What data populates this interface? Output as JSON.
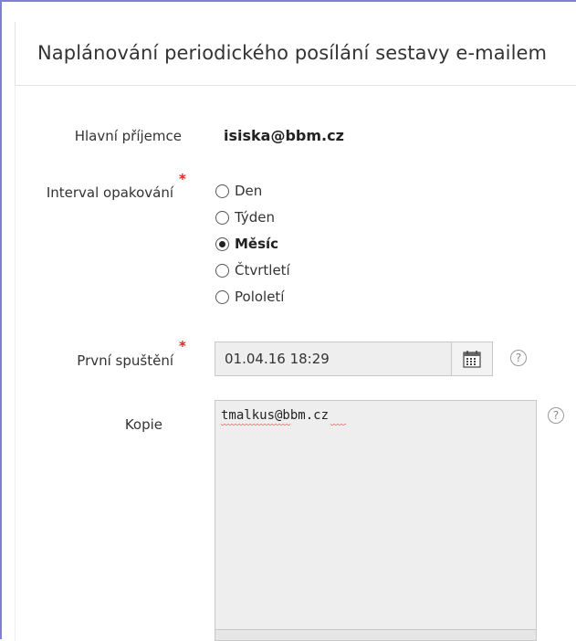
{
  "dialog": {
    "title": "Naplánování periodického posílání sestavy e-mailem"
  },
  "form": {
    "recipient": {
      "label": "Hlavní příjemce",
      "value": "isiska@bbm.cz"
    },
    "interval": {
      "label": "Interval opakování",
      "required_marker": "*",
      "options": [
        {
          "label": "Den",
          "checked": false
        },
        {
          "label": "Týden",
          "checked": false
        },
        {
          "label": "Měsíc",
          "checked": true
        },
        {
          "label": "Čtvrtletí",
          "checked": false
        },
        {
          "label": "Pololetí",
          "checked": false
        }
      ]
    },
    "first_run": {
      "label": "První spuštění",
      "required_marker": "*",
      "value": "01.04.16 18:29"
    },
    "copy": {
      "label": "Kopie",
      "value": "tmalkus@bbm.cz"
    },
    "help_glyph": "?"
  },
  "icons": {
    "calendar": "calendar-icon",
    "help": "help-icon",
    "radio": "radio-icon"
  },
  "colors": {
    "frame_border": "#7f7fd9",
    "required": "#e0231b",
    "input_bg": "#eeeeee",
    "input_border": "#c8c8c8"
  }
}
